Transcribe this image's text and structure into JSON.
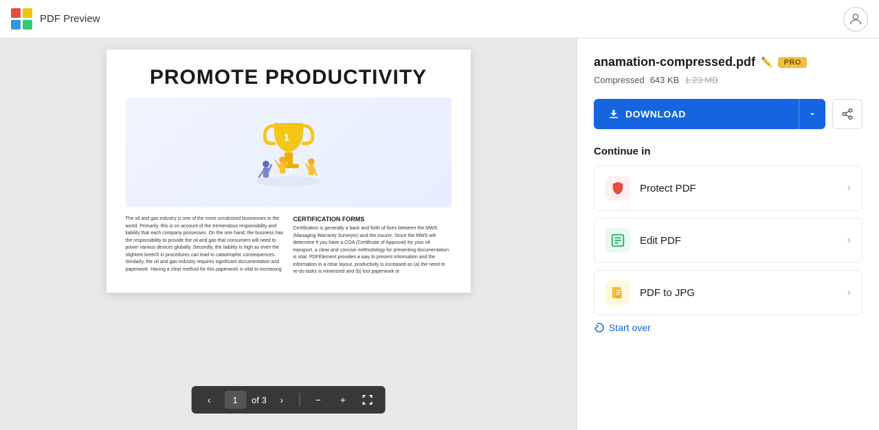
{
  "header": {
    "title": "PDF Preview",
    "avatar_label": "User avatar"
  },
  "pdf": {
    "page_title": "PROMOTE PRODUCTIVITY",
    "body_left": "The oil and gas industry is one of the more scrutinized businesses in the world. Primarily, this is on account of the tremendous responsibility and liability that each company possesses. On the one hand, the business has the responsibility to provide the oil and gas that consumers will need to power various devices globally. Secondly, the liability is high as even the slightest breech in procedures can lead to catastrophic consequences. Similarly, the oil and gas industry requires significant documentation and paperwork. Having a clear method for this paperwork is vital to increasing",
    "section_title": "CERTIFICATION FORMS",
    "body_right": "Certification is generally a back and forth of fixes between the MWS (Managing Warranty Surveyor) and the insurer. Since the MWS will determine if you have a COA (Certificate of Approval) for your oil transport, a clear and concise methodology for presenting documentation is vital. PDFElement provides a way to present information and the information in a clear layout, productivity is increased as (a) the need to re-do tasks is minimized and (b) lost paperwork or"
  },
  "toolbar": {
    "prev_label": "‹",
    "page_number": "1",
    "of_label": "of 3",
    "next_label": "›",
    "zoom_out_label": "−",
    "zoom_in_label": "+",
    "fit_label": "⇔"
  },
  "sidebar": {
    "file_name": "anamation-compressed.pdf",
    "pro_badge": "PRO",
    "status": "Compressed",
    "size": "643 KB",
    "original_size": "1.23 MB",
    "download_label": "DOWNLOAD",
    "continue_label": "Continue in",
    "actions": [
      {
        "name": "Protect PDF",
        "icon": "🛡",
        "icon_class": "icon-protect"
      },
      {
        "name": "Edit PDF",
        "icon": "✏",
        "icon_class": "icon-edit"
      },
      {
        "name": "PDF to JPG",
        "icon": "🖼",
        "icon_class": "icon-jpg"
      }
    ],
    "start_over_label": "Start over"
  }
}
